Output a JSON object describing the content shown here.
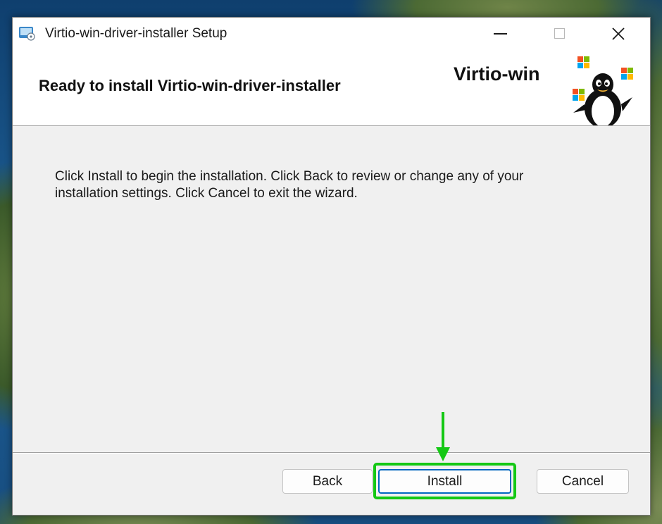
{
  "window": {
    "title": "Virtio-win-driver-installer Setup"
  },
  "banner": {
    "heading": "Ready to install Virtio-win-driver-installer",
    "brand": "Virtio-win"
  },
  "content": {
    "message": "Click Install to begin the installation. Click Back to review or change any of your installation settings. Click Cancel to exit the wizard."
  },
  "buttons": {
    "back": "Back",
    "install": "Install",
    "cancel": "Cancel"
  },
  "icons": {
    "app": "installer-icon",
    "minimize": "minimize-icon",
    "maximize": "maximize-icon",
    "close": "close-icon",
    "logo": "tux-penguin-with-windows-logos",
    "annotation": "green-down-arrow"
  },
  "colors": {
    "highlight": "#14c814",
    "accent": "#0067c0"
  }
}
